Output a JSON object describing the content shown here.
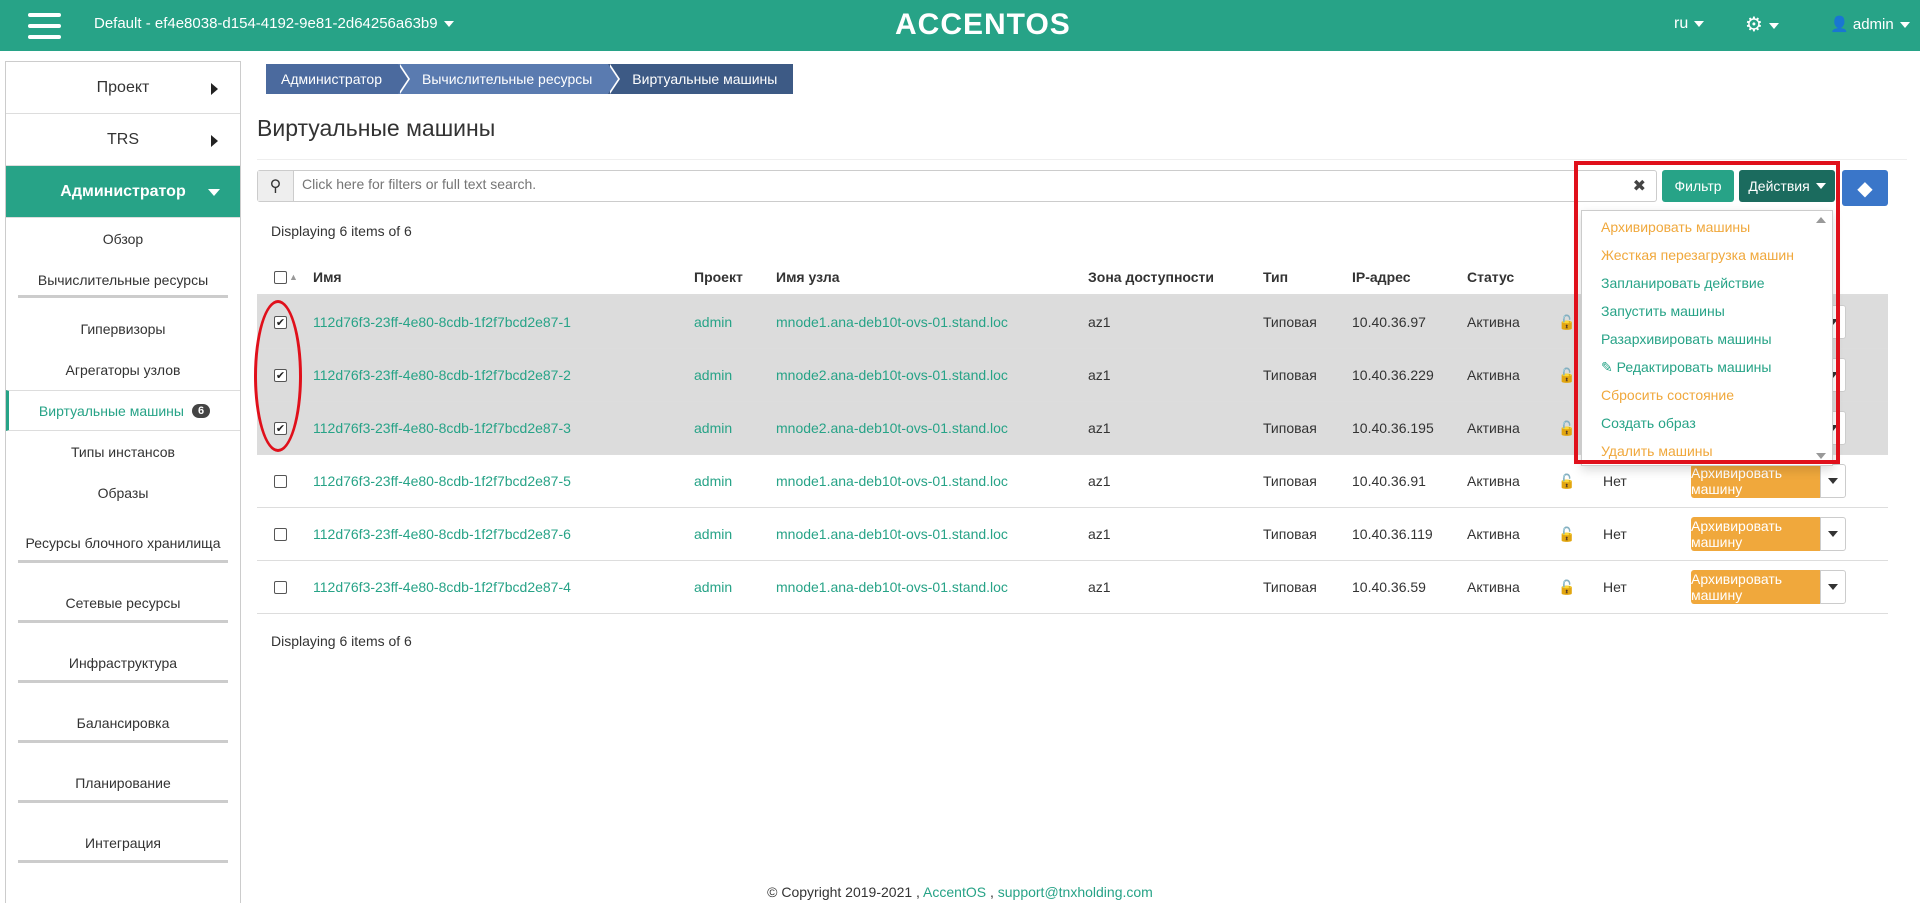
{
  "topbar": {
    "project": "Default - ef4e8038-d154-4192-9e81-2d64256a63b9",
    "brand": "ACCENTOS",
    "lang": "ru",
    "user": "admin"
  },
  "sidebar": {
    "project": "Проект",
    "trs": "TRS",
    "admin": "Администратор",
    "items": {
      "overview": "Обзор",
      "compute": "Вычислительные ресурсы",
      "hypervisors": "Гипервизоры",
      "aggregates": "Агрегаторы узлов",
      "instances": "Виртуальные машины",
      "instances_count": "6",
      "flavors": "Типы инстансов",
      "images": "Образы",
      "volumes": "Ресурсы блочного хранилища",
      "network": "Сетевые ресурсы",
      "infrastructure": "Инфраструктура",
      "balancing": "Балансировка",
      "planning": "Планирование",
      "integration": "Интеграция"
    }
  },
  "breadcrumb": [
    "Администратор",
    "Вычислительные ресурсы",
    "Виртуальные машины"
  ],
  "page_title": "Виртуальные машины",
  "search": {
    "placeholder": "Click here for filters or full text search."
  },
  "buttons": {
    "filter": "Фильтр",
    "actions": "Действия"
  },
  "displaying": "Displaying 6 items of 6",
  "table": {
    "headers": {
      "name": "Имя",
      "project": "Проект",
      "host": "Имя узла",
      "zone": "Зона доступности",
      "type": "Тип",
      "ip": "IP-адрес",
      "status": "Статус"
    },
    "rows": [
      {
        "name": "112d76f3-23ff-4e80-8cdb-1f2f7bcd2e87-1",
        "project": "admin",
        "host": "mnode1.ana-deb10t-ovs-01.stand.loc",
        "zone": "az1",
        "type": "Типовая",
        "ip": "10.40.36.97",
        "status": "Активна",
        "locked": "",
        "action": "",
        "checked": true
      },
      {
        "name": "112d76f3-23ff-4e80-8cdb-1f2f7bcd2e87-2",
        "project": "admin",
        "host": "mnode2.ana-deb10t-ovs-01.stand.loc",
        "zone": "az1",
        "type": "Типовая",
        "ip": "10.40.36.229",
        "status": "Активна",
        "locked": "",
        "action": "",
        "checked": true
      },
      {
        "name": "112d76f3-23ff-4e80-8cdb-1f2f7bcd2e87-3",
        "project": "admin",
        "host": "mnode2.ana-deb10t-ovs-01.stand.loc",
        "zone": "az1",
        "type": "Типовая",
        "ip": "10.40.36.195",
        "status": "Активна",
        "locked": "",
        "action": "",
        "checked": true
      },
      {
        "name": "112d76f3-23ff-4e80-8cdb-1f2f7bcd2e87-5",
        "project": "admin",
        "host": "mnode1.ana-deb10t-ovs-01.stand.loc",
        "zone": "az1",
        "type": "Типовая",
        "ip": "10.40.36.91",
        "status": "Активна",
        "locked": "Нет",
        "action": "Архивировать машину",
        "checked": false
      },
      {
        "name": "112d76f3-23ff-4e80-8cdb-1f2f7bcd2e87-6",
        "project": "admin",
        "host": "mnode1.ana-deb10t-ovs-01.stand.loc",
        "zone": "az1",
        "type": "Типовая",
        "ip": "10.40.36.119",
        "status": "Активна",
        "locked": "Нет",
        "action": "Архивировать машину",
        "checked": false
      },
      {
        "name": "112d76f3-23ff-4e80-8cdb-1f2f7bcd2e87-4",
        "project": "admin",
        "host": "mnode1.ana-deb10t-ovs-01.stand.loc",
        "zone": "az1",
        "type": "Типовая",
        "ip": "10.40.36.59",
        "status": "Активна",
        "locked": "Нет",
        "action": "Архивировать машину",
        "checked": false
      }
    ]
  },
  "actions_menu": [
    {
      "label": "Архивировать машины",
      "color": "orange"
    },
    {
      "label": "Жесткая перезагрузка машин",
      "color": "orange"
    },
    {
      "label": "Запланировать действие",
      "color": "green"
    },
    {
      "label": "Запустить машины",
      "color": "green"
    },
    {
      "label": "Разархивировать машины",
      "color": "green"
    },
    {
      "label": "Редактировать машины",
      "color": "green"
    },
    {
      "label": "Сбросить состояние",
      "color": "orange"
    },
    {
      "label": "Создать образ",
      "color": "green"
    },
    {
      "label": "Удалить машины",
      "color": "orange"
    }
  ],
  "footer": {
    "copyright": "© Copyright 2019-2021 ,",
    "brand": "AccentOS",
    "sep": ",",
    "email": "support@tnxholding.com"
  },
  "colors": {
    "primary": "#27a387",
    "orange": "#f0a83c",
    "highlight": "#e0101b"
  },
  "icons": [
    "menu-icon",
    "search-icon",
    "clear-icon",
    "gear-icon",
    "user-icon",
    "info-icon",
    "lock-icon",
    "pencil-icon"
  ]
}
